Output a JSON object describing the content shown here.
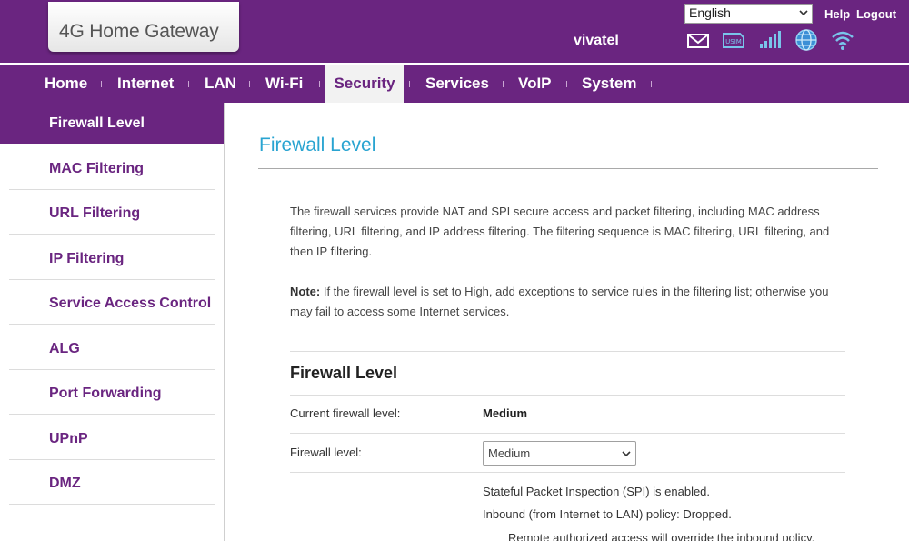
{
  "header": {
    "logo_text": "4G Home Gateway",
    "language": "English",
    "help_label": "Help",
    "logout_label": "Logout",
    "brand": "vivatel",
    "icons": [
      "mail-icon",
      "usim-icon",
      "signal-icon",
      "globe-icon",
      "wifi-icon"
    ],
    "usim_label": "USIM"
  },
  "nav": {
    "items": [
      "Home",
      "Internet",
      "LAN",
      "Wi-Fi",
      "Security",
      "Services",
      "VoIP",
      "System"
    ],
    "active": "Security"
  },
  "sidebar": {
    "items": [
      "Firewall Level",
      "MAC Filtering",
      "URL Filtering",
      "IP Filtering",
      "Service Access Control",
      "ALG",
      "Port Forwarding",
      "UPnP",
      "DMZ"
    ],
    "active": "Firewall Level"
  },
  "main": {
    "page_title": "Firewall Level",
    "description": "The firewall services provide NAT and SPI secure access and packet filtering, including MAC address filtering, URL filtering, and IP address filtering. The filtering sequence is MAC filtering, URL filtering, and then IP filtering.",
    "note_label": "Note:",
    "note_text": " If the firewall level is set to High, add exceptions to service rules in the filtering list; otherwise you may fail to access some Internet services.",
    "section_title": "Firewall Level",
    "current_level_label": "Current firewall level:",
    "current_level_value": "Medium",
    "firewall_level_label": "Firewall level:",
    "firewall_level_selected": "Medium",
    "info_lines": [
      "Stateful Packet Inspection (SPI) is enabled.",
      "Inbound (from Internet to LAN) policy: Dropped.",
      "Remote authorized access will override the inbound policy."
    ]
  },
  "colors": {
    "brand_purple": "#6a2580",
    "title_blue": "#29a4d1",
    "nav_active_bg": "#f2f2f2"
  }
}
